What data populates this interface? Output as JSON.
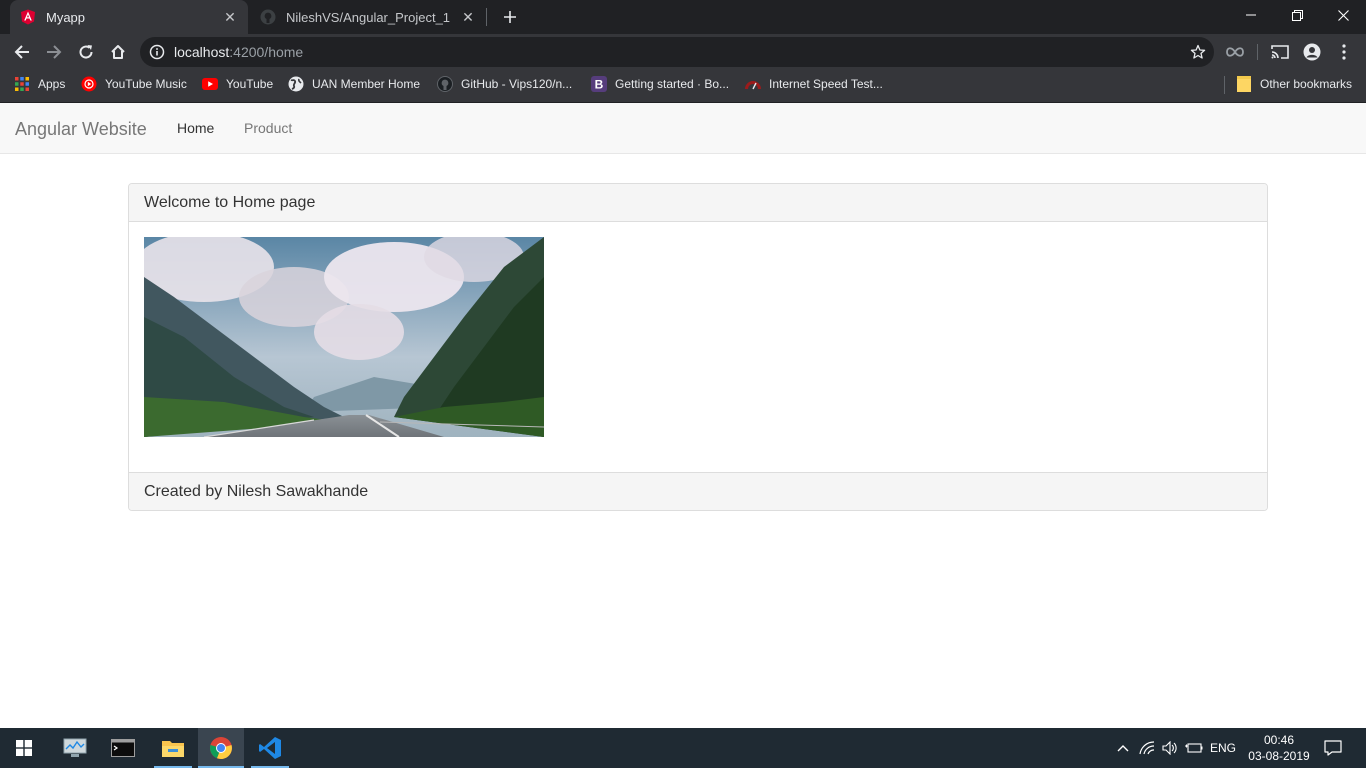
{
  "browser": {
    "tabs": [
      {
        "title": "Myapp"
      },
      {
        "title": "NileshVS/Angular_Project_1"
      }
    ],
    "address": {
      "host": "localhost",
      "path": ":4200/home"
    },
    "bookmarks": [
      {
        "label": "Apps"
      },
      {
        "label": "YouTube Music"
      },
      {
        "label": "YouTube"
      },
      {
        "label": "UAN Member Home"
      },
      {
        "label": "GitHub - Vips120/n..."
      },
      {
        "label": "Getting started · Bo..."
      },
      {
        "label": "Internet Speed Test..."
      }
    ],
    "other_bookmarks": "Other bookmarks"
  },
  "site": {
    "brand": "Angular Website",
    "nav": [
      {
        "label": "Home"
      },
      {
        "label": "Product"
      }
    ],
    "panel": {
      "heading": "Welcome to Home page",
      "footer": "Created by Nilesh Sawakhande"
    }
  },
  "taskbar": {
    "language": "ENG",
    "time": "00:46",
    "date": "03-08-2019"
  },
  "colors": {
    "chrome_dark": "#202124",
    "chrome_toolbar": "#35363a",
    "navbar_bg": "#f8f8f8",
    "panel_bg": "#f5f5f5",
    "taskbar_bg": "#1f2a33",
    "angular_red": "#dd0031"
  }
}
